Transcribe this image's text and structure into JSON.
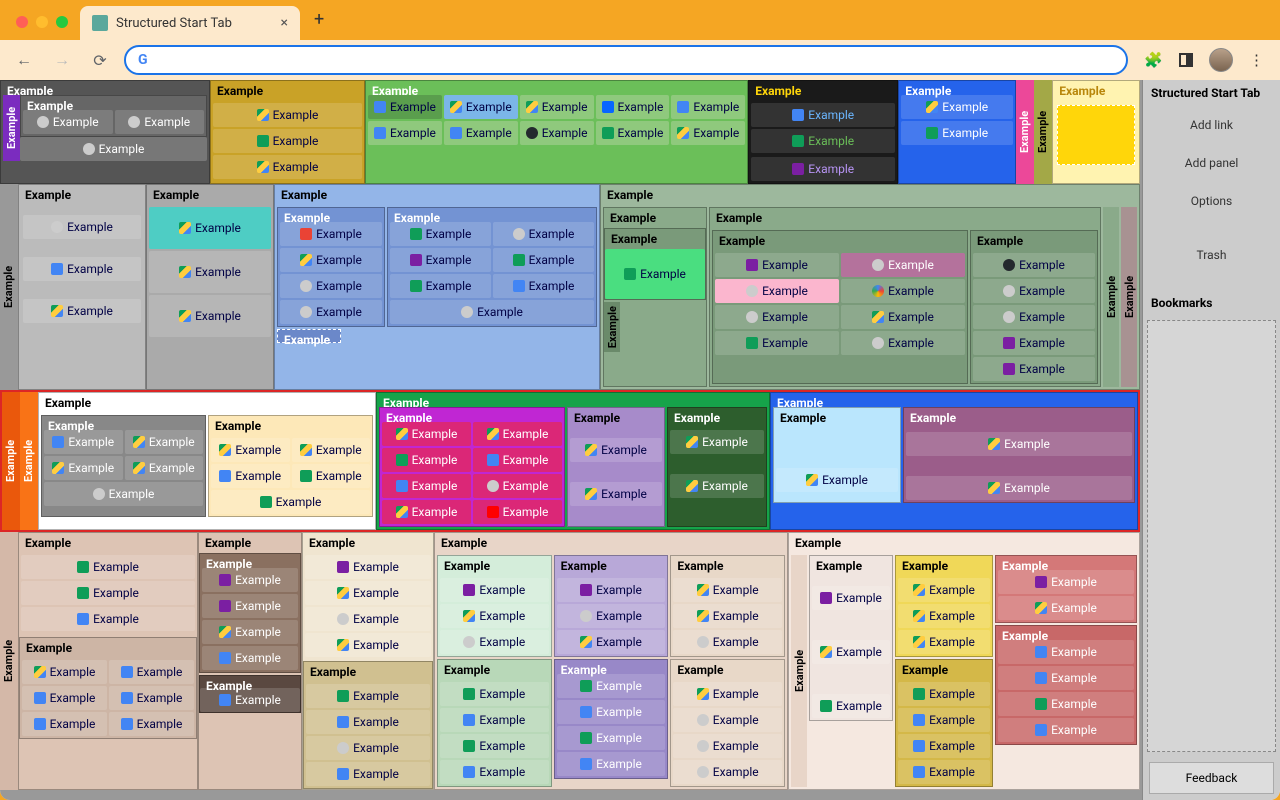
{
  "browser": {
    "tab_title": "Structured Start Tab",
    "omnibox_placeholder": ""
  },
  "sidebar": {
    "title": "Structured Start Tab",
    "add_link": "Add link",
    "add_panel": "Add panel",
    "options": "Options",
    "trash": "Trash",
    "bookmarks": "Bookmarks",
    "feedback": "Feedback"
  },
  "label": "Example"
}
